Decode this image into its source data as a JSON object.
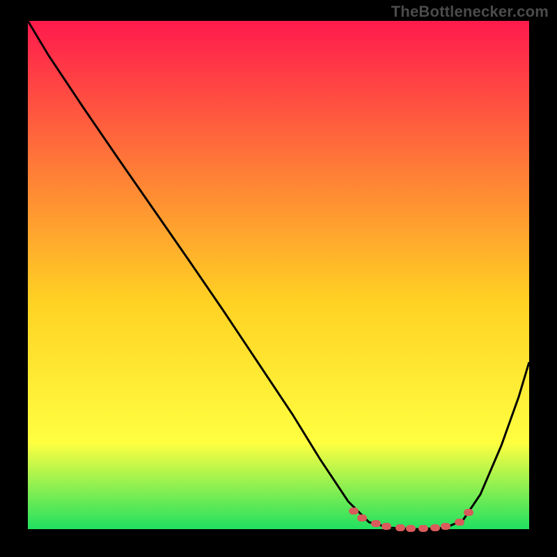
{
  "watermark": "TheBottlenecker.com",
  "chart_data": {
    "type": "line",
    "title": "",
    "xlabel": "",
    "ylabel": "",
    "xlim": [
      40,
      760
    ],
    "ylim": [
      760,
      30
    ],
    "grid": false,
    "legend": false,
    "background_gradient": {
      "top": "#ff1a4d",
      "mid_upper": "#ff7838",
      "mid": "#ffd123",
      "mid_lower": "#ffff40",
      "bottom": "#20e060"
    },
    "series": [
      {
        "name": "bottleneck-curve",
        "color": "#000000",
        "points": [
          {
            "x": 40,
            "y": 30
          },
          {
            "x": 70,
            "y": 80
          },
          {
            "x": 120,
            "y": 155
          },
          {
            "x": 170,
            "y": 228
          },
          {
            "x": 220,
            "y": 300
          },
          {
            "x": 270,
            "y": 372
          },
          {
            "x": 320,
            "y": 445
          },
          {
            "x": 370,
            "y": 520
          },
          {
            "x": 420,
            "y": 595
          },
          {
            "x": 460,
            "y": 660
          },
          {
            "x": 500,
            "y": 720
          },
          {
            "x": 530,
            "y": 750
          },
          {
            "x": 560,
            "y": 758
          },
          {
            "x": 600,
            "y": 760
          },
          {
            "x": 640,
            "y": 758
          },
          {
            "x": 665,
            "y": 747
          },
          {
            "x": 690,
            "y": 710
          },
          {
            "x": 720,
            "y": 640
          },
          {
            "x": 745,
            "y": 570
          },
          {
            "x": 760,
            "y": 520
          }
        ]
      },
      {
        "name": "optimal-range-dots",
        "color": "#d95b5b",
        "points": [
          {
            "x": 508,
            "y": 734
          },
          {
            "x": 520,
            "y": 744
          },
          {
            "x": 540,
            "y": 752
          },
          {
            "x": 555,
            "y": 756
          },
          {
            "x": 575,
            "y": 758
          },
          {
            "x": 590,
            "y": 759
          },
          {
            "x": 608,
            "y": 759
          },
          {
            "x": 625,
            "y": 758
          },
          {
            "x": 640,
            "y": 756
          },
          {
            "x": 660,
            "y": 750
          },
          {
            "x": 673,
            "y": 736
          }
        ]
      }
    ]
  }
}
